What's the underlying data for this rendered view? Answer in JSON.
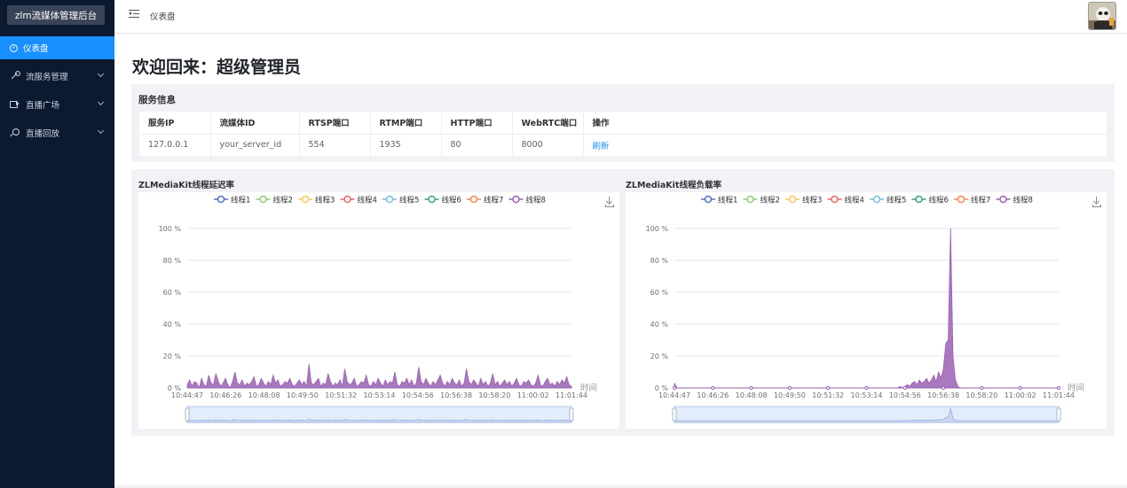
{
  "sidebar": {
    "brand": "zlm流媒体管理后台",
    "items": [
      {
        "label": "仪表盘",
        "icon": "dashboard-icon",
        "active": true
      },
      {
        "label": "流服务管理",
        "icon": "wrench-icon",
        "expandable": true
      },
      {
        "label": "直播广场",
        "icon": "video-icon",
        "expandable": true
      },
      {
        "label": "直播回放",
        "icon": "search-icon",
        "expandable": true
      }
    ]
  },
  "header": {
    "breadcrumb": "仪表盘",
    "avatar": "avatar"
  },
  "main": {
    "welcome": "欢迎回来：超级管理员",
    "service": {
      "title": "服务信息",
      "columns": [
        "服务IP",
        "流媒体ID",
        "RTSP端口",
        "RTMP端口",
        "HTTP端口",
        "WebRTC端口",
        "操作"
      ],
      "row": [
        "127.0.0.1",
        "your_server_id",
        "554",
        "1935",
        "80",
        "8000"
      ],
      "action": "刷新"
    }
  },
  "colors": {
    "accent": "#1890ff",
    "sidebar_bg": "#0b1931",
    "series": [
      "#5470c6",
      "#91cc75",
      "#fac858",
      "#ee6666",
      "#73c0de",
      "#3ba272",
      "#fc8452",
      "#9a60b4"
    ]
  },
  "chart_data": [
    {
      "type": "area",
      "title": "ZLMediaKit线程延迟率",
      "xlabel": "时间",
      "ylabel": "",
      "legend": [
        "线程1",
        "线程2",
        "线程3",
        "线程4",
        "线程5",
        "线程6",
        "线程7",
        "线程8"
      ],
      "legend_position": "top-center",
      "x_ticks": [
        "10:44:47",
        "10:46:26",
        "10:48:08",
        "10:49:50",
        "10:51:32",
        "10:53:14",
        "10:54:56",
        "10:56:38",
        "10:58:20",
        "11:00:02",
        "11:01:44"
      ],
      "y_ticks": [
        "0 %",
        "20 %",
        "40 %",
        "60 %",
        "80 %",
        "100 %"
      ],
      "ylim": [
        0,
        100
      ],
      "grid": true,
      "dataZoom": true,
      "series": [
        {
          "name": "线程8",
          "values": [
            2,
            5,
            1,
            4,
            3,
            0,
            6,
            2,
            1,
            8,
            3,
            2,
            9,
            4,
            1,
            3,
            6,
            2,
            0,
            4,
            10,
            3,
            2,
            5,
            1,
            3,
            2,
            4,
            7,
            1,
            2,
            6,
            3,
            1,
            4,
            2,
            8,
            3,
            5,
            1,
            2,
            4,
            3,
            6,
            2,
            1,
            3,
            5,
            2,
            4,
            1,
            15,
            3,
            2,
            4,
            6,
            1,
            3,
            2,
            9,
            4,
            1,
            3,
            2,
            5,
            1,
            12,
            4,
            2,
            3,
            6,
            1,
            2,
            4,
            3,
            8,
            2,
            1,
            4,
            2,
            6,
            3,
            1,
            5,
            2,
            4,
            3,
            10,
            2,
            1,
            4,
            3,
            6,
            2,
            5,
            1,
            3,
            13,
            4,
            2,
            6,
            3,
            1,
            4,
            2,
            5,
            8,
            3,
            1,
            4,
            2,
            6,
            3,
            2,
            5,
            1,
            3,
            12,
            4,
            2,
            5,
            3,
            1,
            6,
            2,
            4,
            1,
            3,
            9,
            2,
            4,
            1,
            3,
            5,
            2,
            4,
            1,
            3,
            6,
            2,
            1,
            4,
            3,
            5,
            2,
            1,
            3,
            8,
            2,
            1,
            4,
            6,
            2,
            3,
            1,
            4,
            2,
            5,
            3,
            7,
            2,
            1
          ]
        }
      ]
    },
    {
      "type": "area",
      "title": "ZLMediaKit线程负载率",
      "xlabel": "时间",
      "ylabel": "",
      "legend": [
        "线程1",
        "线程2",
        "线程3",
        "线程4",
        "线程5",
        "线程6",
        "线程7",
        "线程8"
      ],
      "legend_position": "top-center",
      "x_ticks": [
        "10:44:47",
        "10:46:26",
        "10:48:08",
        "10:49:50",
        "10:51:32",
        "10:53:14",
        "10:54:56",
        "10:56:38",
        "10:58:20",
        "11:00:02",
        "11:01:44"
      ],
      "y_ticks": [
        "0 %",
        "20 %",
        "40 %",
        "60 %",
        "80 %",
        "100 %"
      ],
      "ylim": [
        0,
        100
      ],
      "grid": true,
      "dataZoom": true,
      "series": [
        {
          "name": "线程8",
          "values": [
            3,
            0,
            0,
            0,
            0,
            0,
            0,
            0,
            0,
            0,
            0,
            0,
            0,
            0,
            0,
            0,
            0,
            0,
            0,
            0,
            0,
            0,
            0,
            0,
            0,
            0,
            0,
            0,
            0,
            0,
            0,
            0,
            0,
            0,
            0,
            0,
            0,
            0,
            0,
            0,
            0,
            0,
            0,
            0,
            0,
            0,
            0,
            0,
            0,
            0,
            0,
            0,
            0,
            0,
            0,
            0,
            0,
            0,
            0,
            0,
            0,
            0,
            0,
            0,
            0,
            0,
            0,
            0,
            0,
            0,
            0,
            0,
            0,
            0,
            0,
            0,
            0,
            0,
            0,
            0,
            0,
            0,
            0,
            0,
            0,
            0,
            0,
            0,
            0,
            0,
            0,
            0,
            0,
            0,
            1,
            0,
            1,
            2,
            1,
            3,
            4,
            2,
            5,
            3,
            4,
            6,
            3,
            5,
            8,
            4,
            10,
            6,
            12,
            28,
            30,
            100,
            20,
            5,
            1,
            0,
            0,
            0,
            0,
            0,
            0,
            0,
            0,
            0,
            0,
            0,
            0,
            0,
            0,
            0,
            0,
            0,
            0,
            0,
            0,
            0,
            0,
            0,
            0,
            0,
            0,
            0,
            0,
            0,
            0,
            0,
            0,
            0,
            0,
            0,
            0,
            0,
            0,
            0,
            0,
            0,
            0
          ]
        }
      ]
    }
  ]
}
